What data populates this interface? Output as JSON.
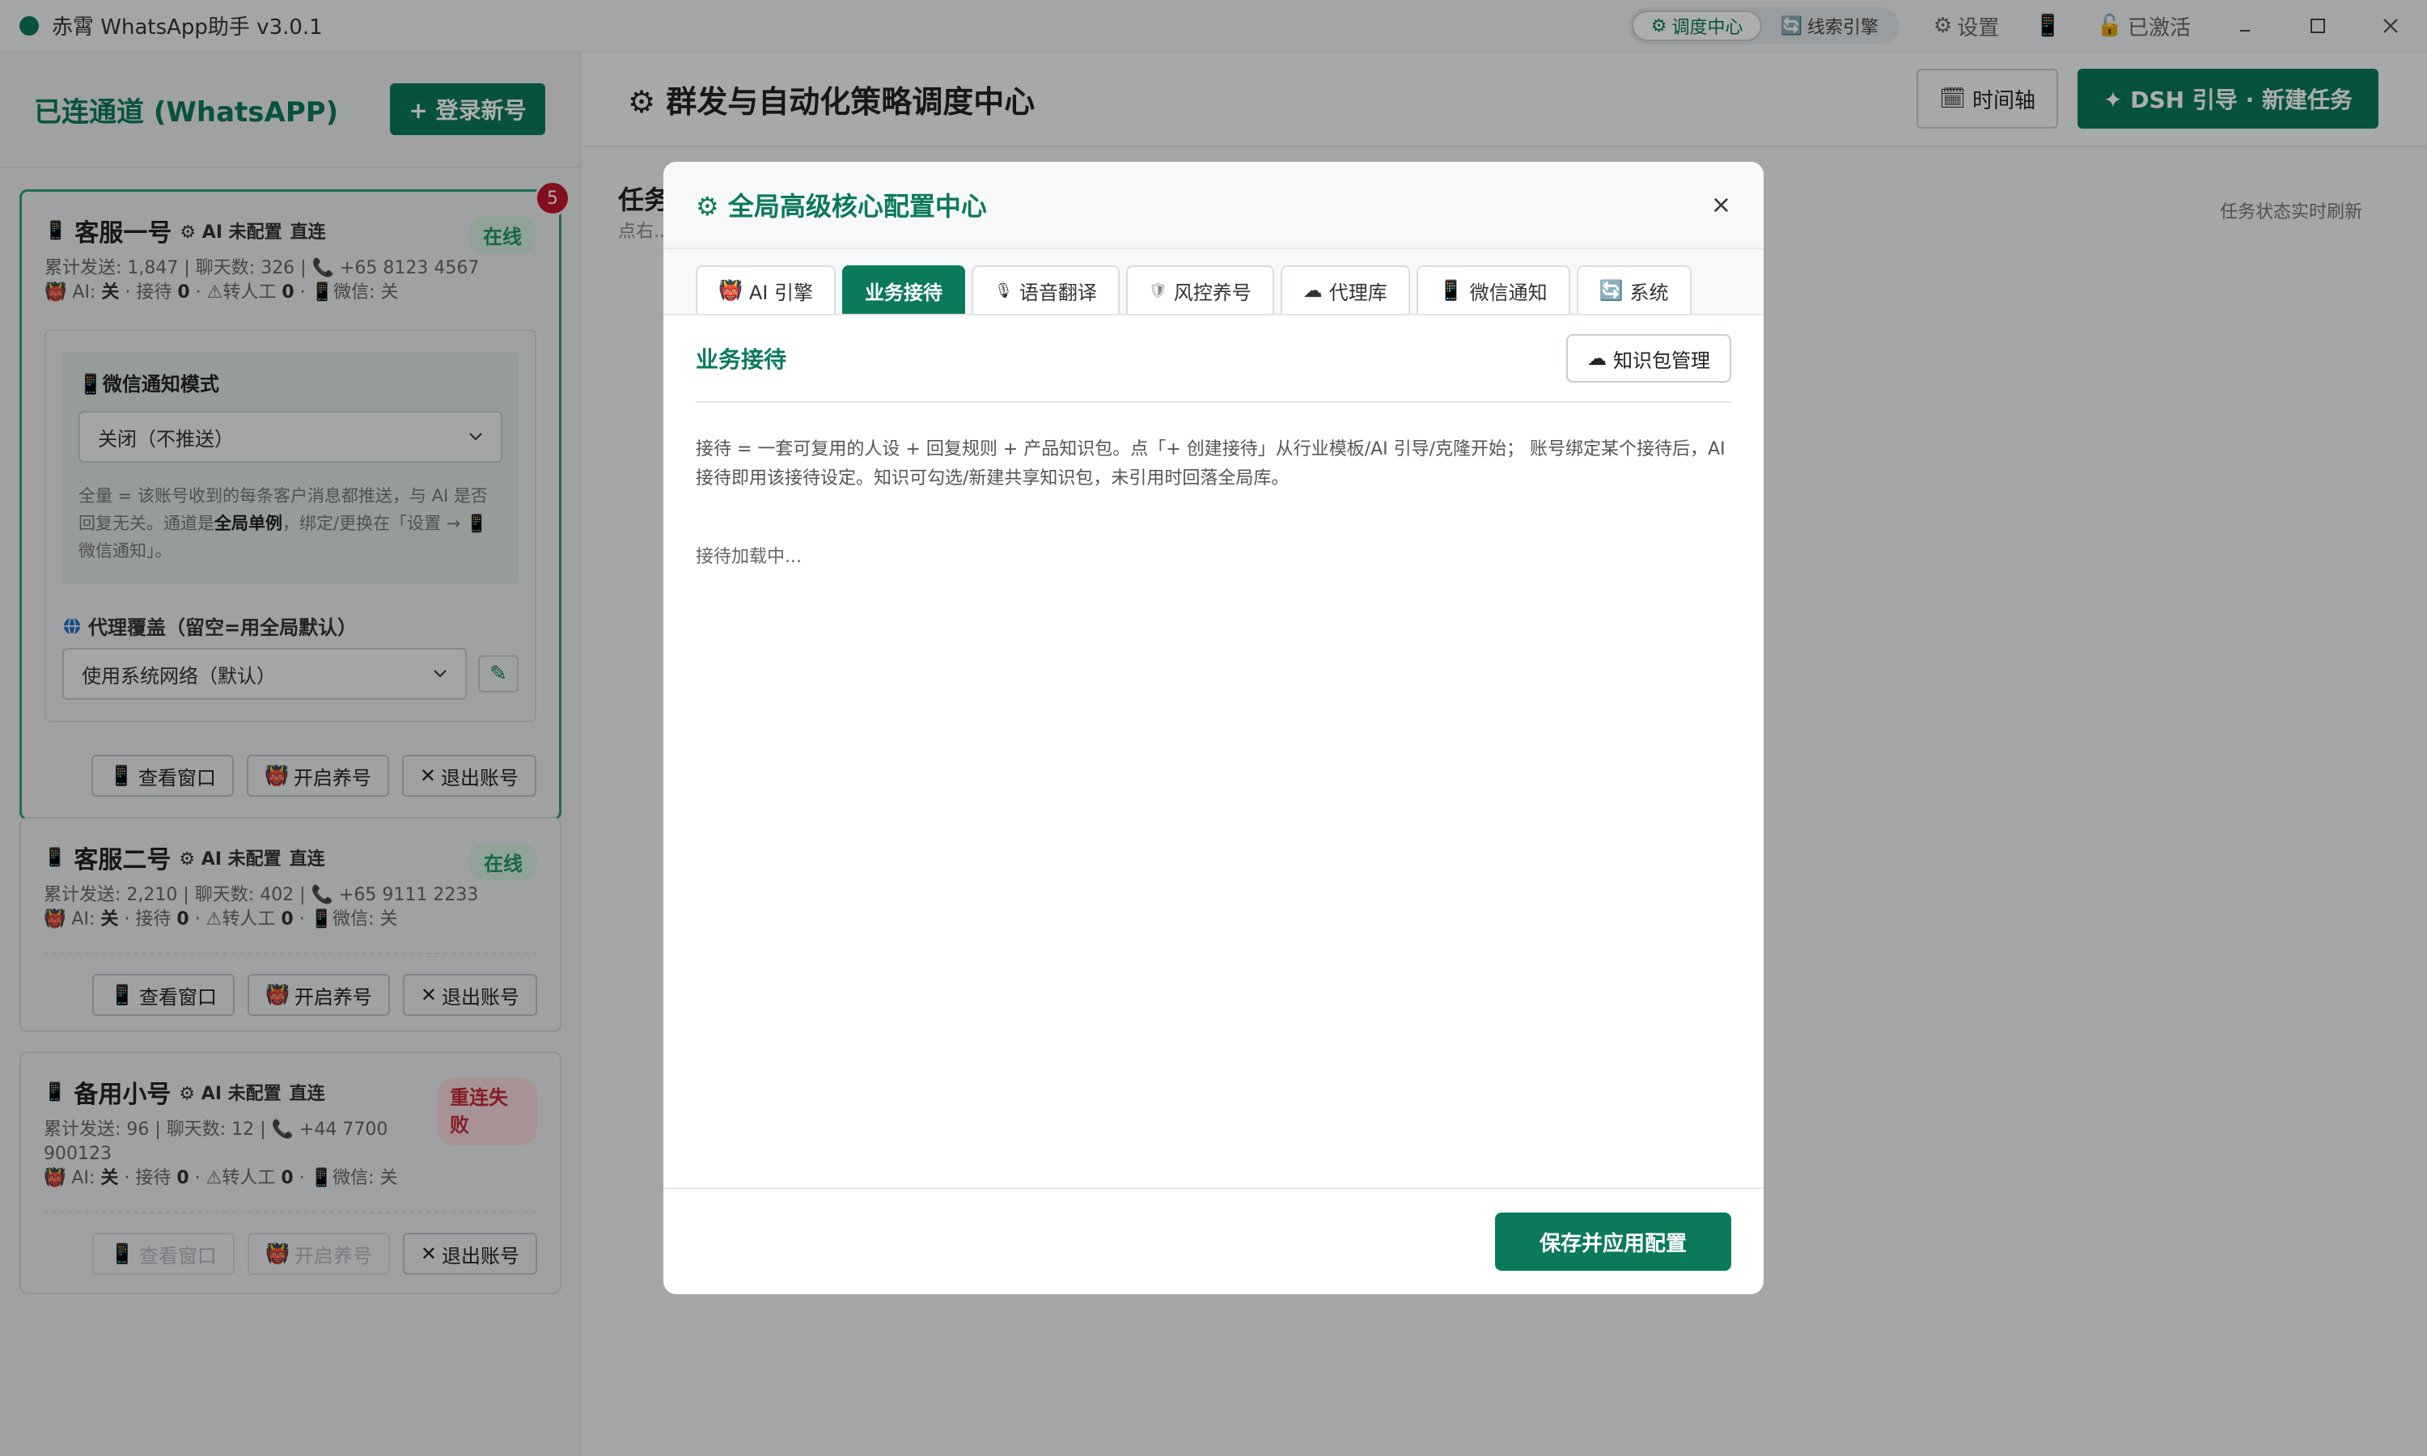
{
  "titlebar": {
    "app_title": "赤霄 WhatsApp助手 v3.0.1",
    "nav": [
      {
        "label": "调度中心",
        "icon": "⚙"
      },
      {
        "label": "线索引擎",
        "icon": "🔄"
      }
    ],
    "settings_label": "设置",
    "settings_icon": "⚙",
    "phone_icon": "📱",
    "activated_label": "已激活",
    "activated_icon": "🔓"
  },
  "sidebar": {
    "title": "已连通道 (WhatsAPP)",
    "login_button": "+ 登录新号",
    "accounts": [
      {
        "name": "客服一号",
        "ai_status": "⚙ AI 未配置",
        "conn": "直连",
        "status": "在线",
        "badge": "5",
        "stats_prefix": "累计发送: 1,847 | 聊天数: 326 | ",
        "phone": "+65 8123 4567",
        "ai_line": {
          "ai_label": "AI:",
          "ai_value": "关",
          "reception_label": " · 接待 ",
          "reception_value": "0",
          "transfer_label": " · ⚠转人工 ",
          "transfer_value": "0",
          "wechat_label": "微信:",
          "wechat_value": "关"
        },
        "wechat_mode_title": "微信通知模式",
        "wechat_mode_value": "关闭（不推送）",
        "wechat_desc_1": "全量 = 该账号收到的每条客户消息都推送，与 AI 是否回复无关。通道是",
        "wechat_desc_bold": "全局单例",
        "wechat_desc_2": "，绑定/更换在「设置 → 📱 微信通知」。",
        "proxy_title": "代理覆盖（留空=用全局默认）",
        "proxy_value": "使用系统网络（默认）",
        "actions": [
          "查看窗口",
          "开启养号",
          "退出账号"
        ]
      },
      {
        "name": "客服二号",
        "ai_status": "⚙ AI 未配置",
        "conn": "直连",
        "status": "在线",
        "stats_prefix": "累计发送: 2,210 | 聊天数: 402 | ",
        "phone": "+65 9111 2233",
        "ai_line": {
          "ai_label": "AI:",
          "ai_value": "关",
          "reception_label": " · 接待 ",
          "reception_value": "0",
          "transfer_label": " · ⚠转人工 ",
          "transfer_value": "0",
          "wechat_label": "微信:",
          "wechat_value": "关"
        },
        "actions": [
          "查看窗口",
          "开启养号",
          "退出账号"
        ]
      },
      {
        "name": "备用小号",
        "ai_status": "⚙ AI 未配置",
        "conn": "直连",
        "status": "重连失败",
        "stats_prefix": "累计发送: 96 | 聊天数: 12 | ",
        "phone": "+44 7700 900123",
        "ai_line": {
          "ai_label": "AI:",
          "ai_value": "关",
          "reception_label": " · 接待 ",
          "reception_value": "0",
          "transfer_label": " · ⚠转人工 ",
          "transfer_value": "0",
          "wechat_label": "微信:",
          "wechat_value": "关"
        },
        "actions": [
          "查看窗口",
          "开启养号",
          "退出账号"
        ]
      }
    ]
  },
  "main": {
    "title": "⚙ 群发与自动化策略调度中心",
    "timeline_button": "时间轴",
    "dsh_button": "✦ DSH 引导 · 新建任务",
    "task_title": "任务",
    "task_sub": "点右...",
    "refresh_note": "任务状态实时刷新"
  },
  "modal": {
    "title": "⚙ 全局高级核心配置中心",
    "close": "×",
    "tabs": [
      {
        "icon": "👹",
        "label": "AI 引擎"
      },
      {
        "icon": "",
        "label": "业务接待"
      },
      {
        "icon": "🎙",
        "label": "语音翻译"
      },
      {
        "icon": "🛡",
        "label": "风控养号"
      },
      {
        "icon": "☁",
        "label": "代理库"
      },
      {
        "icon": "📱",
        "label": "微信通知"
      },
      {
        "icon": "🔄",
        "label": "系统"
      }
    ],
    "section_title": "业务接待",
    "kb_button": "知识包管理",
    "desc": "接待 = 一套可复用的人设 + 回复规则 + 产品知识包。点「+ 创建接待」从行业模板/AI 引导/克隆开始； 账号绑定某个接待后，AI 接待即用该接待设定。知识可勾选/新建共享知识包，未引用时回落全局库。",
    "loading": "接待加载中...",
    "save_button": "保存并应用配置"
  },
  "colors": {
    "accent": "#0b7a5c",
    "online": "#1f9a63",
    "error": "#c62a3a",
    "badge": "#c0172c"
  }
}
